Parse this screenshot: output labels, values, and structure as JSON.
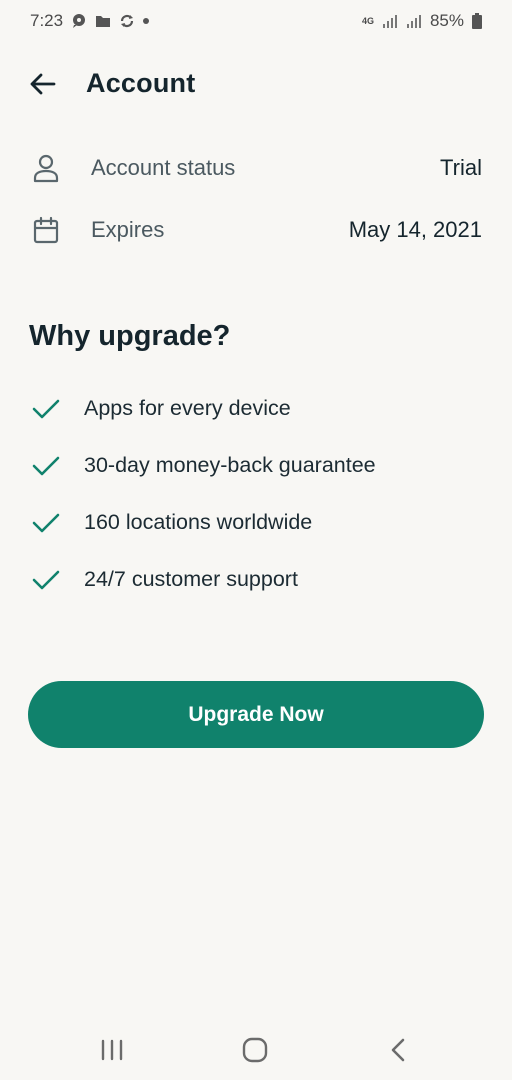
{
  "status_bar": {
    "time": "7:23",
    "network": "4G",
    "battery": "85%",
    "icons": [
      "chat-bubble-icon",
      "folder-icon",
      "sync-icon",
      "dot-icon",
      "signal-icon",
      "signal-icon",
      "battery-icon"
    ]
  },
  "header": {
    "title": "Account",
    "back_icon": "arrow-left-icon"
  },
  "account": {
    "status_label": "Account status",
    "status_value": "Trial",
    "status_icon": "person-icon",
    "expires_label": "Expires",
    "expires_value": "May 14, 2021",
    "expires_icon": "calendar-icon"
  },
  "upgrade": {
    "title": "Why upgrade?",
    "features": [
      "Apps for every device",
      "30-day money-back guarantee",
      "160 locations worldwide",
      "24/7 customer support"
    ],
    "feature_icon": "checkmark-icon",
    "button_label": "Upgrade Now"
  },
  "nav_bar": {
    "icons": [
      "recent-apps-icon",
      "home-icon",
      "back-icon"
    ]
  },
  "colors": {
    "background": "#f8f7f4",
    "accent": "#10826c",
    "text": "#15252d"
  }
}
